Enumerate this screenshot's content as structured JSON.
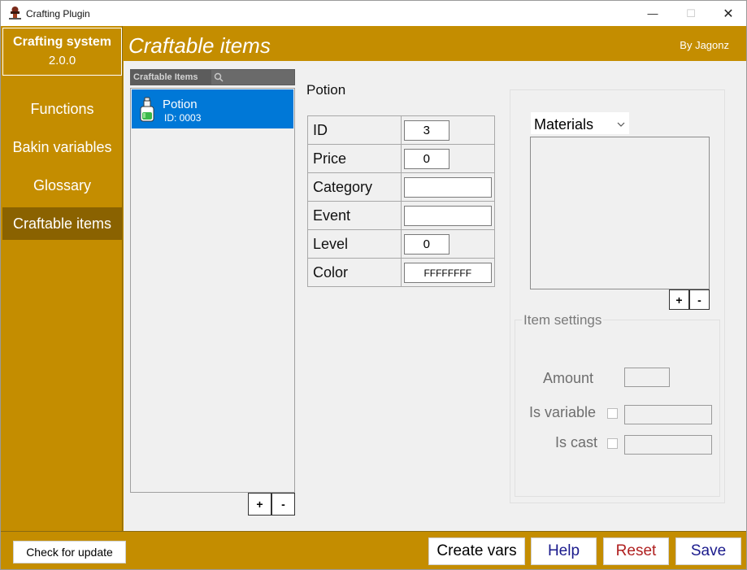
{
  "window": {
    "title": "Crafting Plugin",
    "controls": {
      "minimize": "—",
      "maximize": "☐",
      "close": "✕"
    }
  },
  "brand": {
    "title": "Crafting system",
    "version": "2.0.0"
  },
  "sidebar": {
    "items": [
      {
        "label": "Functions"
      },
      {
        "label": "Bakin variables"
      },
      {
        "label": "Glossary"
      },
      {
        "label": "Craftable items",
        "active": true
      }
    ]
  },
  "header": {
    "title": "Craftable items",
    "by": "By Jagonz"
  },
  "item_list": {
    "header": "Craftable Items",
    "search_icon": "search-icon",
    "items": [
      {
        "name": "Potion",
        "id": "ID: 0003",
        "selected": true
      }
    ],
    "add_label": "+",
    "remove_label": "-"
  },
  "item": {
    "title": "Potion",
    "fields": [
      {
        "key": "ID",
        "value": "3"
      },
      {
        "key": "Price",
        "value": "0"
      },
      {
        "key": "Category",
        "value": ""
      },
      {
        "key": "Event",
        "value": ""
      },
      {
        "key": "Level",
        "value": "0"
      },
      {
        "key": "Color",
        "value": "FFFFFFFF"
      }
    ]
  },
  "materials": {
    "select_value": "Materials",
    "add_label": "+",
    "remove_label": "-"
  },
  "item_settings": {
    "title": "Item settings",
    "amount_label": "Amount",
    "amount_value": "",
    "is_variable_label": "Is variable",
    "is_variable_value": "",
    "is_cast_label": "Is cast",
    "is_cast_value": ""
  },
  "footer": {
    "check_update": "Check for update",
    "create_vars": "Create vars",
    "help": "Help",
    "reset": "Reset",
    "save": "Save"
  },
  "colors": {
    "accent": "#c48d00",
    "active_nav": "#8a6200",
    "selection": "#0078d7",
    "help_text": "#1a1a8c",
    "reset_text": "#b02020",
    "save_text": "#1a1a8c"
  }
}
